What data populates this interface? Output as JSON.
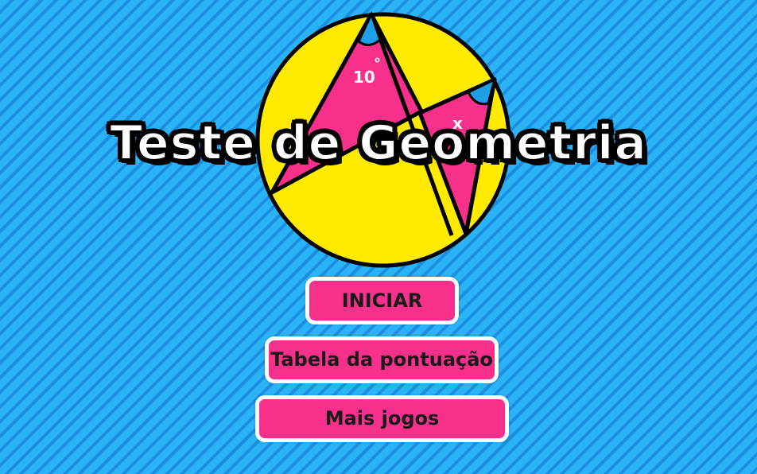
{
  "logo": {
    "angle_a_label": "10",
    "angle_a_unit": "°",
    "angle_b_label": "x",
    "circle_color": "#ffea00",
    "triangle_color": "#f7318b",
    "angle_marker_color": "#1e9fe8"
  },
  "title": "Teste de Geometria",
  "menu": {
    "start_label": "INICIAR",
    "scores_label": "Tabela da pontuação",
    "more_label": "Mais jogos"
  },
  "colors": {
    "background": "#2ab4f7",
    "stripe": "#1a8ee0",
    "button": "#f7318b",
    "button_border": "#ffffff"
  }
}
